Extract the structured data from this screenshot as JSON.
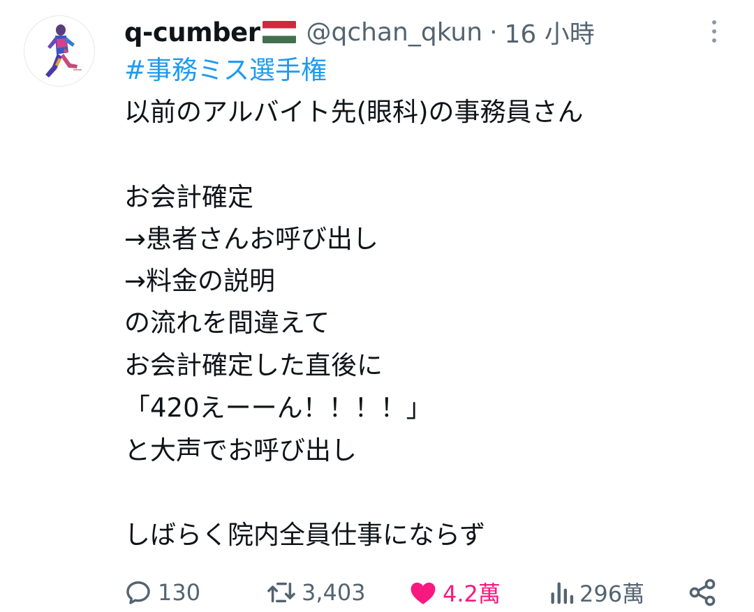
{
  "tweet": {
    "author": {
      "display_name": "q-cumber",
      "flag_emoji": "hungary-flag",
      "handle": "@qchan_qkun",
      "separator": "·",
      "timestamp": "16 小時"
    },
    "hashtag": "#事務ミス選手権",
    "body_lines": [
      "以前のアルバイト先(眼科)の事務員さん",
      "",
      "お会計確定",
      "→患者さんお呼び出し",
      "→料金の説明",
      "の流れを間違えて",
      "お会計確定した直後に",
      "「420えーーん！！！！」",
      "と大声でお呼び出し",
      "",
      "しばらく院内全員仕事にならず"
    ]
  },
  "actions": {
    "reply": {
      "icon": "reply-icon",
      "count": "130"
    },
    "retweet": {
      "icon": "retweet-icon",
      "count": "3,403"
    },
    "like": {
      "icon": "heart-icon",
      "count": "4.2萬",
      "liked": true
    },
    "views": {
      "icon": "views-icon",
      "count": "296萬"
    },
    "share": {
      "icon": "share-icon"
    }
  },
  "colors": {
    "text": "#0f1419",
    "secondary": "#536471",
    "link": "#1d9bf0",
    "like": "#f91880"
  }
}
